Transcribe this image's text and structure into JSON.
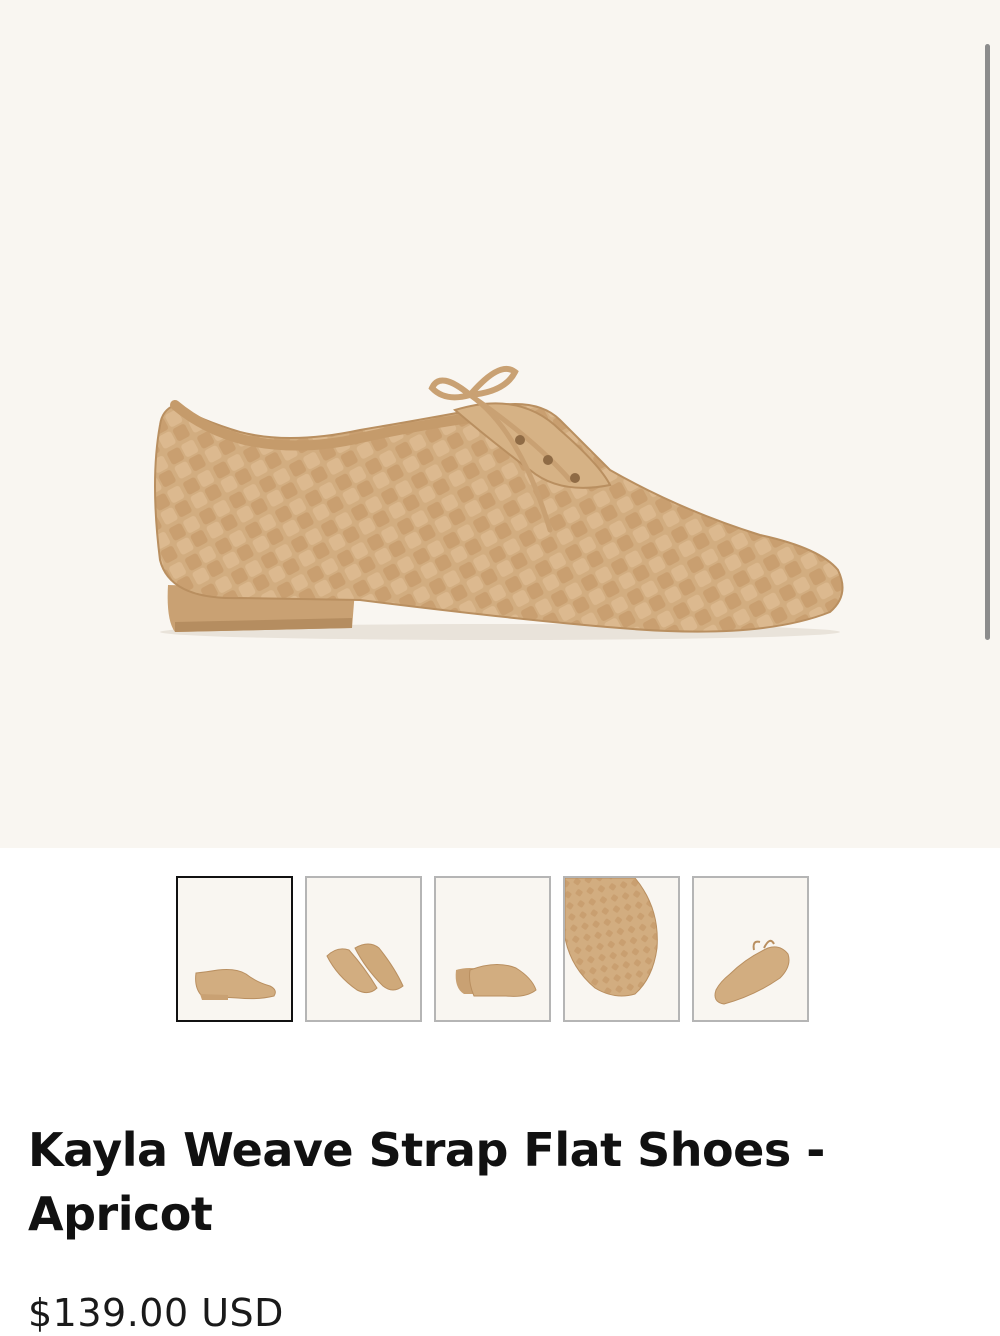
{
  "product": {
    "title_line1": "Kayla Weave Strap Flat Shoes -",
    "title_line2": "Apricot",
    "price": "$139.00 USD",
    "main_image": "woven-lace-up-flat-shoe-side-view",
    "colors": {
      "shoe": "#d2ad80",
      "background": "#f9f6f1",
      "active_border": "#111111",
      "inactive_border": "#b5b5b5"
    }
  },
  "gallery": {
    "thumbnails": [
      {
        "image": "side-view",
        "active": true
      },
      {
        "image": "pair-front-view",
        "active": false
      },
      {
        "image": "pair-back-view",
        "active": false
      },
      {
        "image": "close-up-top-view",
        "active": false
      },
      {
        "image": "angled-view",
        "active": false
      }
    ]
  }
}
